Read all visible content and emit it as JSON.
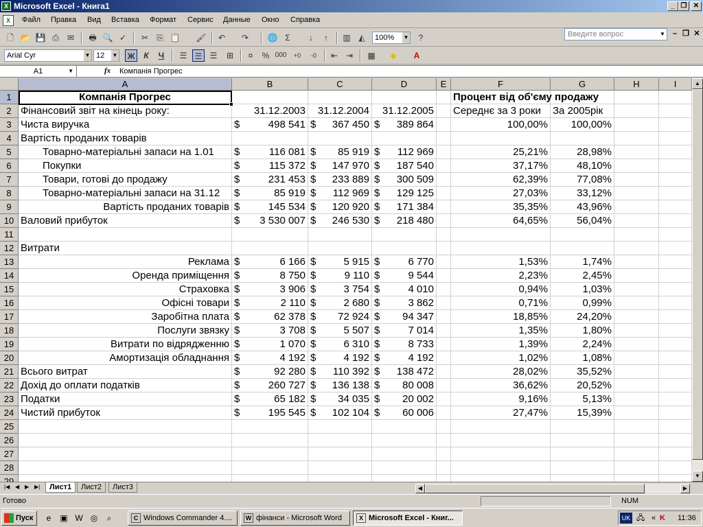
{
  "window": {
    "title": "Microsoft Excel - Книга1"
  },
  "menu": [
    "Файл",
    "Правка",
    "Вид",
    "Вставка",
    "Формат",
    "Сервис",
    "Данные",
    "Окно",
    "Справка"
  ],
  "help_placeholder": "Введите вопрос",
  "toolbar": {
    "zoom": "100%",
    "font": "Arial Cyr",
    "size": "12"
  },
  "formula": {
    "cell": "A1",
    "content": "Компанія Прогрес"
  },
  "columns": [
    "A",
    "B",
    "C",
    "D",
    "E",
    "F",
    "G",
    "H",
    "I"
  ],
  "rows": [
    "1",
    "2",
    "3",
    "4",
    "5",
    "6",
    "7",
    "8",
    "9",
    "10",
    "11",
    "12",
    "13",
    "14",
    "15",
    "16",
    "17",
    "18",
    "19",
    "20",
    "21",
    "22",
    "23",
    "24",
    "25",
    "26",
    "27",
    "28",
    "29"
  ],
  "cells": {
    "r1": {
      "a": "Компанія Прогрес",
      "f": "Процент від об'єму продажу"
    },
    "r2": {
      "a": "Фінансовий звіт на кінець року:",
      "b": "31.12.2003",
      "c": "31.12.2004",
      "d": "31.12.2005",
      "f": "Середнє за 3 роки",
      "g": "За 2005рік"
    },
    "r3": {
      "a": "Чиста виручка",
      "b": "498 541",
      "c": "367 450",
      "d": "389 864",
      "f": "100,00%",
      "g": "100,00%"
    },
    "r4": {
      "a": "Вартість проданих товарів"
    },
    "r5": {
      "a": "Товарно-матеріальні запаси на 1.01",
      "b": "116 081",
      "c": "85 919",
      "d": "112 969",
      "f": "25,21%",
      "g": "28,98%"
    },
    "r6": {
      "a": "Покупки",
      "b": "115 372",
      "c": "147 970",
      "d": "187 540",
      "f": "37,17%",
      "g": "48,10%"
    },
    "r7": {
      "a": "Товари, готові до продажу",
      "b": "231 453",
      "c": "233 889",
      "d": "300 509",
      "f": "62,39%",
      "g": "77,08%"
    },
    "r8": {
      "a": "Товарно-матеріальні запаси на 31.12",
      "b": "85 919",
      "c": "112 969",
      "d": "129 125",
      "f": "27,03%",
      "g": "33,12%"
    },
    "r9": {
      "a": "Вартість проданих товарів",
      "b": "145 534",
      "c": "120 920",
      "d": "171 384",
      "f": "35,35%",
      "g": "43,96%"
    },
    "r10": {
      "a": "Валовий прибуток",
      "b": "3 530 007",
      "c": "246 530",
      "d": "218 480",
      "f": "64,65%",
      "g": "56,04%"
    },
    "r12": {
      "a": "Витрати"
    },
    "r13": {
      "a": "Реклама",
      "b": "6 166",
      "c": "5 915",
      "d": "6 770",
      "f": "1,53%",
      "g": "1,74%"
    },
    "r14": {
      "a": "Оренда приміщення",
      "b": "8 750",
      "c": "9 110",
      "d": "9 544",
      "f": "2,23%",
      "g": "2,45%"
    },
    "r15": {
      "a": "Страховка",
      "b": "3 906",
      "c": "3 754",
      "d": "4 010",
      "f": "0,94%",
      "g": "1,03%"
    },
    "r16": {
      "a": "Офісні товари",
      "b": "2 110",
      "c": "2 680",
      "d": "3 862",
      "f": "0,71%",
      "g": "0,99%"
    },
    "r17": {
      "a": "Заробітна плата",
      "b": "62 378",
      "c": "72 924",
      "d": "94 347",
      "f": "18,85%",
      "g": "24,20%"
    },
    "r18": {
      "a": "Послуги звязку",
      "b": "3 708",
      "c": "5 507",
      "d": "7 014",
      "f": "1,35%",
      "g": "1,80%"
    },
    "r19": {
      "a": "Витрати по відрядженню",
      "b": "1 070",
      "c": "6 310",
      "d": "8 733",
      "f": "1,39%",
      "g": "2,24%"
    },
    "r20": {
      "a": "Амортизація обладнання",
      "b": "4 192",
      "c": "4 192",
      "d": "4 192",
      "f": "1,02%",
      "g": "1,08%"
    },
    "r21": {
      "a": "Всього витрат",
      "b": "92 280",
      "c": "110 392",
      "d": "138 472",
      "f": "28,02%",
      "g": "35,52%"
    },
    "r22": {
      "a": "Дохід до оплати податків",
      "b": "260 727",
      "c": "136 138",
      "d": "80 008",
      "f": "36,62%",
      "g": "20,52%"
    },
    "r23": {
      "a": "Податки",
      "b": "65 182",
      "c": "34 035",
      "d": "20 002",
      "f": "9,16%",
      "g": "5,13%"
    },
    "r24": {
      "a": "Чистий прибуток",
      "b": "195 545",
      "c": "102 104",
      "d": "60 006",
      "f": "27,47%",
      "g": "15,39%"
    }
  },
  "currency": "$",
  "sheets": [
    "Лист1",
    "Лист2",
    "Лист3"
  ],
  "status": {
    "ready": "Готово",
    "num": "NUM"
  },
  "taskbar": {
    "start": "Пуск",
    "tasks": [
      "Windows Commander 4....",
      "фінанси - Microsoft Word",
      "Microsoft Excel - Книг..."
    ],
    "lang": "UK",
    "clock": "11:36"
  }
}
